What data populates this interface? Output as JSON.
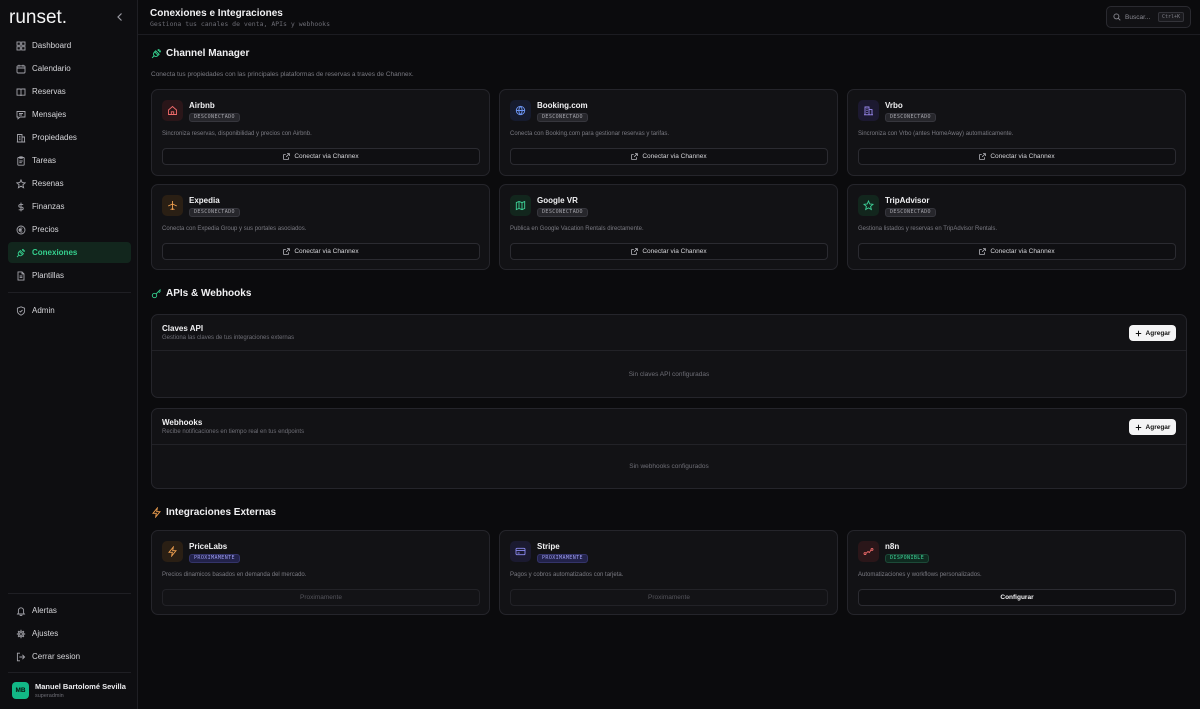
{
  "sidebar": {
    "logo": "runset.",
    "nav": [
      {
        "label": "Dashboard",
        "icon": "grid-icon"
      },
      {
        "label": "Calendario",
        "icon": "calendar-icon"
      },
      {
        "label": "Reservas",
        "icon": "book-icon"
      },
      {
        "label": "Mensajes",
        "icon": "message-icon"
      },
      {
        "label": "Propiedades",
        "icon": "building-icon"
      },
      {
        "label": "Tareas",
        "icon": "clipboard-icon"
      },
      {
        "label": "Resenas",
        "icon": "star-icon"
      },
      {
        "label": "Finanzas",
        "icon": "dollar-icon"
      },
      {
        "label": "Precios",
        "icon": "euro-icon"
      },
      {
        "label": "Conexiones",
        "icon": "plug-icon",
        "active": true
      },
      {
        "label": "Plantillas",
        "icon": "file-icon"
      }
    ],
    "admin": {
      "label": "Admin",
      "icon": "shield-icon"
    },
    "bottom": [
      {
        "label": "Alertas",
        "icon": "bell-icon"
      },
      {
        "label": "Ajustes",
        "icon": "gear-icon"
      },
      {
        "label": "Cerrar sesion",
        "icon": "logout-icon"
      }
    ],
    "user": {
      "initials": "MB",
      "name": "Manuel Bartolomé Sevilla",
      "role": "superadmin"
    }
  },
  "header": {
    "title": "Conexiones e Integraciones",
    "subtitle": "Gestiona tus canales de venta, APIs y webhooks",
    "search_placeholder": "Buscar...",
    "search_shortcut": "Ctrl+K"
  },
  "channel_manager": {
    "title": "Channel Manager",
    "description": "Conecta tus propiedades con las principales plataformas de reservas a traves de Channex.",
    "cards": [
      {
        "name": "Airbnb",
        "status": "DESCONECTADO",
        "desc": "Sincroniza reservas, disponibilidad y precios con Airbnb.",
        "button": "Conectar via Channex",
        "icon": "home-icon",
        "color": "#f06b6b",
        "bg": "#2a1619"
      },
      {
        "name": "Booking.com",
        "status": "DESCONECTADO",
        "desc": "Conecta con Booking.com para gestionar reservas y tarifas.",
        "button": "Conectar via Channex",
        "icon": "globe-icon",
        "color": "#6b93f0",
        "bg": "#161b2e"
      },
      {
        "name": "Vrbo",
        "status": "DESCONECTADO",
        "desc": "Sincroniza con Vrbo (antes HomeAway) automaticamente.",
        "button": "Conectar via Channex",
        "icon": "buildings-icon",
        "color": "#9b8af0",
        "bg": "#1c1930"
      },
      {
        "name": "Expedia",
        "status": "DESCONECTADO",
        "desc": "Conecta con Expedia Group y sus portales asociados.",
        "button": "Conectar via Channex",
        "icon": "plane-icon",
        "color": "#f0a050",
        "bg": "#2a1f14"
      },
      {
        "name": "Google VR",
        "status": "DESCONECTADO",
        "desc": "Publica en Google Vacation Rentals directamente.",
        "button": "Conectar via Channex",
        "icon": "map-icon",
        "color": "#3fd59a",
        "bg": "#12261d"
      },
      {
        "name": "TripAdvisor",
        "status": "DESCONECTADO",
        "desc": "Gestiona listados y reservas en TripAdvisor Rentals.",
        "button": "Conectar via Channex",
        "icon": "star-icon",
        "color": "#3fd59a",
        "bg": "#12261d"
      }
    ]
  },
  "apis": {
    "title": "APIs & Webhooks",
    "panels": [
      {
        "title": "Claves API",
        "subtitle": "Gestiona las claves de tus integraciones externas",
        "button": "Agregar",
        "empty": "Sin claves API configuradas"
      },
      {
        "title": "Webhooks",
        "subtitle": "Recibe notificaciones en tiempo real en tus endpoints",
        "button": "Agregar",
        "empty": "Sin webhooks configurados"
      }
    ]
  },
  "external": {
    "title": "Integraciones Externas",
    "cards": [
      {
        "name": "PriceLabs",
        "status": "PROXIMAMENTE",
        "desc": "Precios dinamicos basados en demanda del mercado.",
        "button": "Proximamente",
        "icon": "bolt-icon",
        "color": "#f0a050",
        "bg": "#2a1f14"
      },
      {
        "name": "Stripe",
        "status": "PROXIMAMENTE",
        "desc": "Pagos y cobros automatizados con tarjeta.",
        "button": "Proximamente",
        "icon": "card-icon",
        "color": "#8b8af0",
        "bg": "#1b1a30"
      },
      {
        "name": "n8n",
        "status": "DISPONIBLE",
        "desc": "Automatizaciones y workflows personalizados.",
        "button": "Configurar",
        "icon": "workflow-icon",
        "color": "#f06b6b",
        "bg": "#2a1619"
      }
    ]
  }
}
